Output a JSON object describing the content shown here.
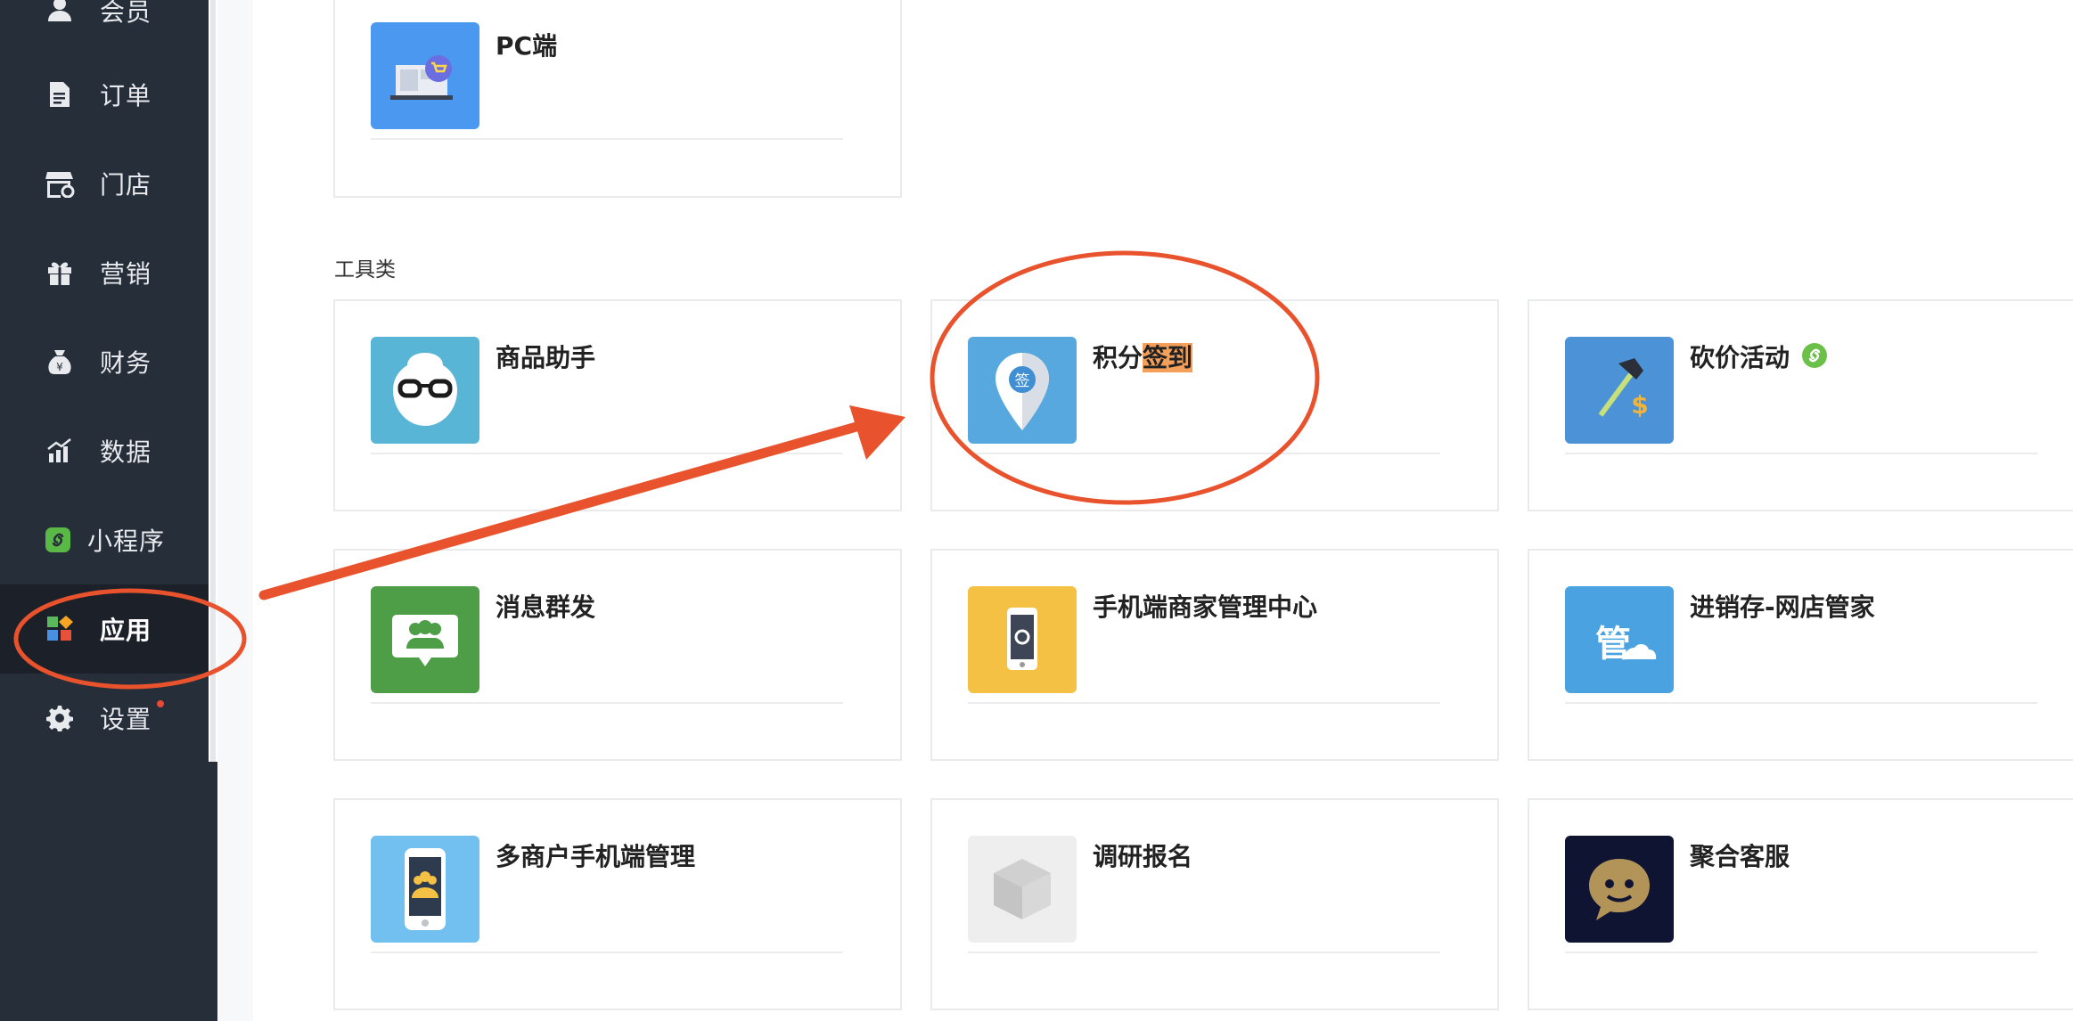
{
  "sidebar": {
    "items": [
      {
        "label": "会员",
        "icon": "user-icon"
      },
      {
        "label": "订单",
        "icon": "document-icon"
      },
      {
        "label": "门店",
        "icon": "store-icon"
      },
      {
        "label": "营销",
        "icon": "gift-icon"
      },
      {
        "label": "财务",
        "icon": "money-bag-icon"
      },
      {
        "label": "数据",
        "icon": "chart-icon"
      },
      {
        "label": "小程序",
        "icon": "mini-program-icon"
      },
      {
        "label": "应用",
        "icon": "apps-icon",
        "active": true
      },
      {
        "label": "设置",
        "icon": "gear-icon",
        "badge": true
      }
    ]
  },
  "channel_section": {
    "cards": [
      {
        "title": "PC端",
        "icon": "pc-shop-icon",
        "color": "#4a98f0"
      }
    ]
  },
  "tools_section": {
    "title": "工具类",
    "cards": [
      {
        "title": "商品助手",
        "icon": "glasses-icon",
        "color": "#59b5d6"
      },
      {
        "title_part1": "积分",
        "title_part2": "签到",
        "icon": "checkin-pin-icon",
        "color": "#58a8e0"
      },
      {
        "title": "砍价活动",
        "icon": "axe-dollar-icon",
        "color": "#4b93d6"
      },
      {
        "title": "消息群发",
        "icon": "group-message-icon",
        "color": "#4e9e48"
      },
      {
        "title": "手机端商家管理中心",
        "icon": "phone-settings-icon",
        "color": "#f5c144"
      },
      {
        "title": "进销存-网店管家",
        "icon": "cloud-manager-icon",
        "color": "#4aa3e0"
      },
      {
        "title": "多商户手机端管理",
        "icon": "phone-merchants-icon",
        "color": "#72c0f0"
      },
      {
        "title": "调研报名",
        "icon": "box-icon",
        "color": "#eeeeee"
      },
      {
        "title": "聚合客服",
        "icon": "customer-service-icon",
        "color": "#101433"
      }
    ]
  },
  "annotations": {
    "color": "#e8522c"
  }
}
